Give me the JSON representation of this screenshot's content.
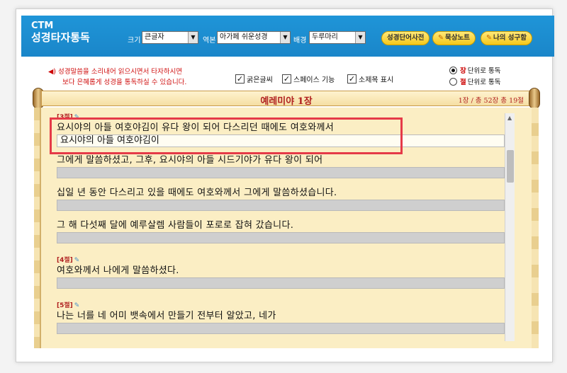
{
  "header": {
    "logo_line1": "CTM",
    "logo_line2": "성경타자통독",
    "size_label": "크기",
    "size_value": "큰글자",
    "version_label": "역본",
    "version_value": "아가페 쉬운성경",
    "background_label": "배경",
    "background_value": "두루마리",
    "buttons": {
      "dictionary": "성경단어사전",
      "meditation": "묵상노트",
      "my_verses": "나의 성구함"
    }
  },
  "options": {
    "notice_line1": "성경말씀을 소리내어 읽으시면서 타자하시면",
    "notice_line2": "보다 은혜롭게 성경을 통독하실 수 있습니다.",
    "checkbox_bold": "굵은글씨",
    "checkbox_space": "스페이스 기능",
    "checkbox_subtitle": "소제목 표시",
    "radio_chapter_hl": "장",
    "radio_chapter": "단위로 통독",
    "radio_verse_hl": "절",
    "radio_verse": "단위로 통독"
  },
  "scroll": {
    "book_title": "예레미야 1장",
    "chapter_info": "1장 / 총 52장  총 19절"
  },
  "verses": {
    "v3_num": "[3절]",
    "v3_line1": "요시야의 아들 여호야김이 유다 왕이 되어 다스리던 때에도 여호와께서",
    "v3_typed": "요시야의 아들 여호야김이",
    "v3_line2": "그에게 말씀하셨고, 그후, 요시야의 아들 시드기야가 유다 왕이 되어",
    "v3_line3": "십일 년 동안 다스리고 있을 때에도 여호와께서 그에게 말씀하셨습니다.",
    "v3_line4": "그 해 다섯째 달에 예루살렘 사람들이 포로로 잡혀 갔습니다.",
    "v4_num": "[4절]",
    "v4_line1": "여호와께서 나에게 말씀하셨다.",
    "v5_num": "[5절]",
    "v5_line1": "나는 너를 네 어미 뱃속에서 만들기 전부터 알았고, 네가"
  },
  "colors": {
    "header_blue": "#1a86c9",
    "parchment": "#fbeec4",
    "title_red": "#b02020",
    "highlight_box": "#e53a48"
  }
}
